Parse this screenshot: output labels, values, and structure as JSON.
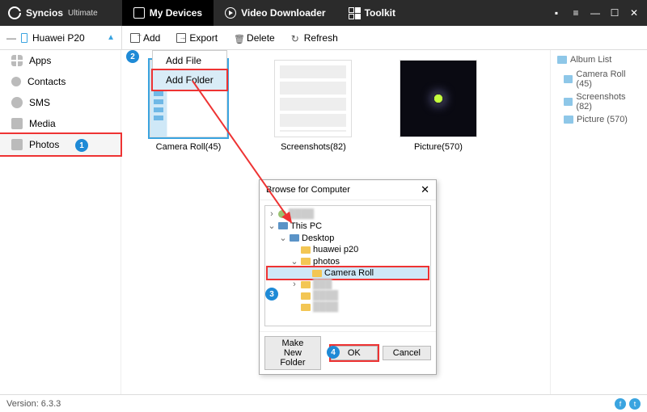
{
  "app": {
    "name": "Syncios",
    "edition": "Ultimate"
  },
  "nav": {
    "devices": "My Devices",
    "downloader": "Video Downloader",
    "toolkit": "Toolkit"
  },
  "device": {
    "name": "Huawei P20"
  },
  "toolbar": {
    "add": "Add",
    "export": "Export",
    "delete": "Delete",
    "refresh": "Refresh"
  },
  "add_menu": {
    "file": "Add File",
    "folder": "Add Folder"
  },
  "sidebar": {
    "apps": "Apps",
    "contacts": "Contacts",
    "sms": "SMS",
    "media": "Media",
    "photos": "Photos"
  },
  "albums": [
    {
      "label": "Camera Roll(45)"
    },
    {
      "label": "Screenshots(82)"
    },
    {
      "label": "Picture(570)"
    }
  ],
  "right": {
    "title": "Album List",
    "items": [
      "Camera Roll (45)",
      "Screenshots (82)",
      "Picture (570)"
    ]
  },
  "dialog": {
    "title": "Browse for Computer",
    "this_pc": "This PC",
    "desktop": "Desktop",
    "huawei": "huawei p20",
    "photos": "photos",
    "camera": "Camera Roll",
    "make_folder": "Make New Folder",
    "ok": "OK",
    "cancel": "Cancel"
  },
  "footer": {
    "version": "Version: 6.3.3"
  },
  "badges": {
    "b1": "1",
    "b2": "2",
    "b3": "3",
    "b4": "4"
  }
}
